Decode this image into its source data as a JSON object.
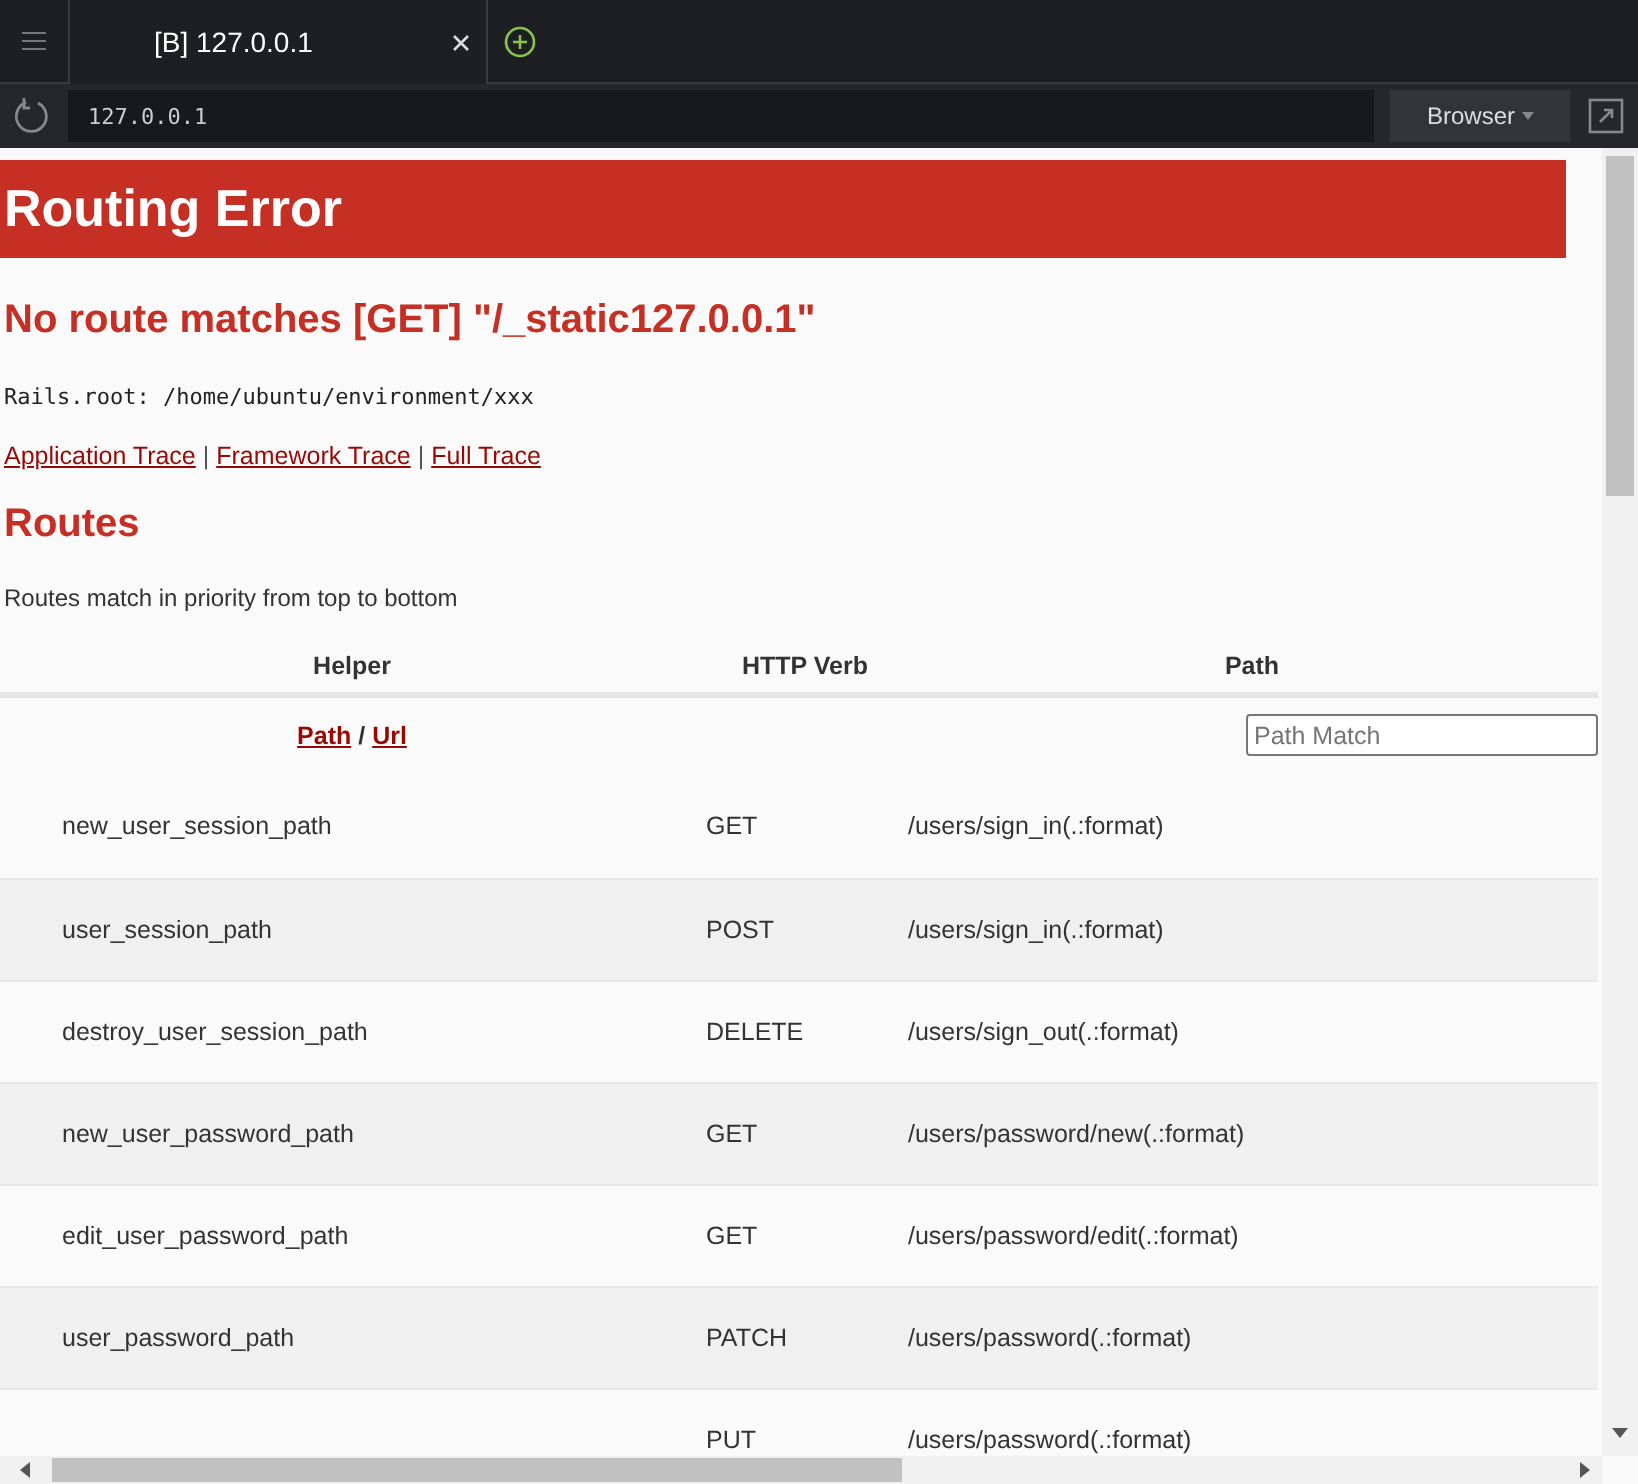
{
  "tabs": [
    {
      "label": "[B] 127.0.0.1",
      "selected": true
    }
  ],
  "address_bar": {
    "value": "127.0.0.1"
  },
  "browser_button": "Browser",
  "page": {
    "banner": "Routing Error",
    "error": "No route matches [GET] \"/_static127.0.0.1\"",
    "rails_root": "Rails.root: /home/ubuntu/environment/xxx",
    "trace_links": [
      "Application Trace",
      "Framework Trace",
      "Full Trace"
    ],
    "trace_separator": "|",
    "helper_separator": "/",
    "routes_heading": "Routes",
    "routes_note": "Routes match in priority from top to bottom",
    "columns": [
      "Helper",
      "HTTP Verb",
      "Path"
    ],
    "helper_links": [
      "Path",
      "Url"
    ],
    "path_filter": {
      "placeholder": "Path Match"
    },
    "rows": [
      {
        "helper": "new_user_session_path",
        "verb": "GET",
        "path": "/users/sign_in(.:format)"
      },
      {
        "helper": "user_session_path",
        "verb": "POST",
        "path": "/users/sign_in(.:format)"
      },
      {
        "helper": "destroy_user_session_path",
        "verb": "DELETE",
        "path": "/users/sign_out(.:format)"
      },
      {
        "helper": "new_user_password_path",
        "verb": "GET",
        "path": "/users/password/new(.:format)"
      },
      {
        "helper": "edit_user_password_path",
        "verb": "GET",
        "path": "/users/password/edit(.:format)"
      },
      {
        "helper": "user_password_path",
        "verb": "PATCH",
        "path": "/users/password(.:format)"
      },
      {
        "verb": "PUT",
        "path": "/users/password(.:format)"
      }
    ]
  }
}
